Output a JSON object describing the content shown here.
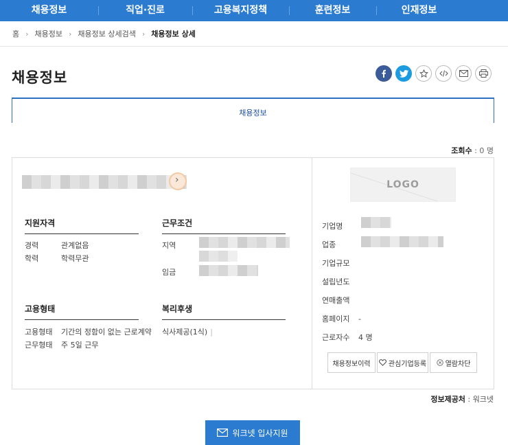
{
  "gnb": {
    "items": [
      "채용정보",
      "직업·진로",
      "고용복지정책",
      "훈련정보",
      "인재정보"
    ]
  },
  "breadcrumb": [
    "홈",
    "채용정보",
    "채용정보 상세검색",
    "채용정보 상세"
  ],
  "page_title": "채용정보",
  "share": {
    "icons": [
      "facebook-icon",
      "twitter-icon",
      "star-icon",
      "code-icon",
      "mail-icon",
      "print-icon"
    ]
  },
  "tab": {
    "label": "채용정보"
  },
  "views": {
    "label": "조회수",
    "value": " : 0 명"
  },
  "qualification": {
    "title": "지원자격",
    "rows": [
      {
        "label": "경력",
        "value": "관계없음"
      },
      {
        "label": "학력",
        "value": "학력무관"
      }
    ]
  },
  "conditions": {
    "title": "근무조건",
    "rows": [
      {
        "label": "지역",
        "value": ""
      },
      {
        "label": "임금",
        "value": ""
      }
    ]
  },
  "employment": {
    "title": "고용형태",
    "rows": [
      {
        "label": "고용형태",
        "value": "기간의 정함이 없는 근로계약"
      },
      {
        "label": "근무형태",
        "value": "주 5일 근무"
      }
    ]
  },
  "welfare": {
    "title": "복리후생",
    "value": "식사제공(1식)"
  },
  "company": {
    "logo_text": "LOGO",
    "rows": [
      {
        "label": "기업명",
        "value": ""
      },
      {
        "label": "업종",
        "value": ""
      },
      {
        "label": "기업규모",
        "value": ""
      },
      {
        "label": "설립년도",
        "value": ""
      },
      {
        "label": "연매출액",
        "value": ""
      },
      {
        "label": "홈페이지",
        "value": "-"
      },
      {
        "label": "근로자수",
        "value": "4 명"
      }
    ],
    "buttons": [
      "채용정보이력",
      "관심기업등록",
      "열람차단"
    ]
  },
  "provider": {
    "label": "정보제공처",
    "value": " : 워크넷"
  },
  "apply_button": {
    "label": "워크넷 입사지원"
  },
  "colors": {
    "primary": "#2b7cd0",
    "tab_border": "#2b6fbe"
  }
}
